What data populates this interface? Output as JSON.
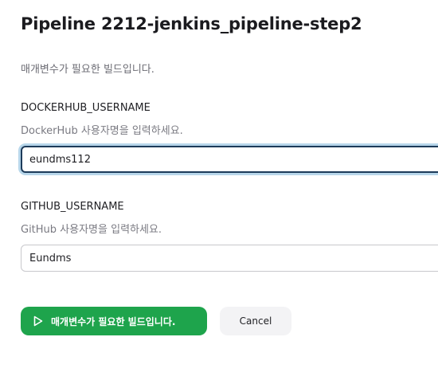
{
  "page": {
    "title": "Pipeline 2212-jenkins_pipeline-step2",
    "subtitle": "매개변수가 필요한 빌드입니다."
  },
  "parameters": [
    {
      "name": "DOCKERHUB_USERNAME",
      "description": "DockerHub 사용자명을 입력하세요.",
      "value": "eundms112",
      "focused": true
    },
    {
      "name": "GITHUB_USERNAME",
      "description": "GitHub  사용자명을 입력하세요.",
      "value": "Eundms",
      "focused": false
    }
  ],
  "actions": {
    "build_label": "매개변수가 필요한 빌드입니다.",
    "build_icon": "play-icon",
    "cancel_label": "Cancel"
  },
  "colors": {
    "build_button": "#1ea44c",
    "focus_border": "#1d3b5a",
    "focus_ring": "#b7d6ea",
    "cancel_button": "#f3f3f5"
  }
}
